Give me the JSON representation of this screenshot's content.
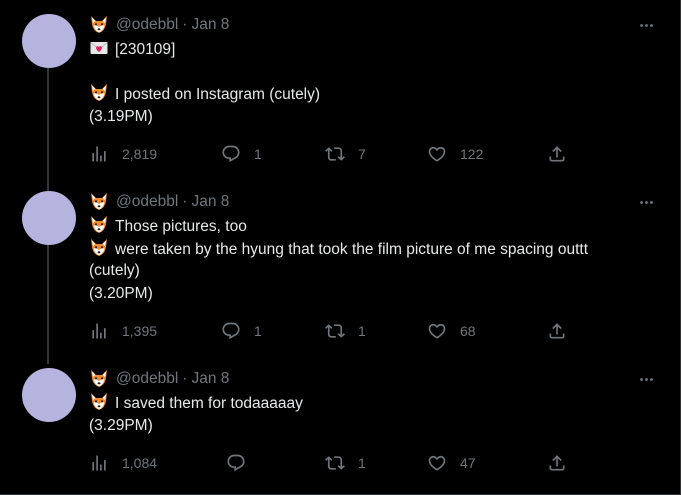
{
  "tweets": [
    {
      "handle": "@odebbl",
      "dot": "·",
      "date": "Jan 8",
      "lines": [
        "[230109]",
        "",
        "I posted on Instagram (cutely)",
        "(3.19PM)"
      ],
      "line_emojis": [
        "envelope-heart",
        "",
        "fox",
        ""
      ],
      "stats": {
        "views": "2,819",
        "replies": "1",
        "retweets": "7",
        "likes": "122"
      }
    },
    {
      "handle": "@odebbl",
      "dot": "·",
      "date": "Jan 8",
      "lines": [
        "Those pictures, too",
        "were taken by the hyung that took the film picture of me spacing outtt",
        "(cutely)",
        "(3.20PM)"
      ],
      "line_emojis": [
        "fox",
        "fox",
        "",
        ""
      ],
      "stats": {
        "views": "1,395",
        "replies": "1",
        "retweets": "1",
        "likes": "68"
      }
    },
    {
      "handle": "@odebbl",
      "dot": "·",
      "date": "Jan 8",
      "lines": [
        "I saved them for todaaaaay",
        "(3.29PM)"
      ],
      "line_emojis": [
        "fox",
        ""
      ],
      "stats": {
        "views": "1,084",
        "replies": "",
        "retweets": "1",
        "likes": "47"
      }
    }
  ],
  "colors": {
    "background": "#000000",
    "text": "#e7e9ea",
    "muted": "#71767b",
    "avatar": "#b7b3df",
    "thread_line": "#333639"
  },
  "icons": [
    "fox-emoji",
    "envelope-heart-emoji",
    "more-icon",
    "views-icon",
    "reply-icon",
    "retweet-icon",
    "like-icon",
    "share-icon"
  ]
}
